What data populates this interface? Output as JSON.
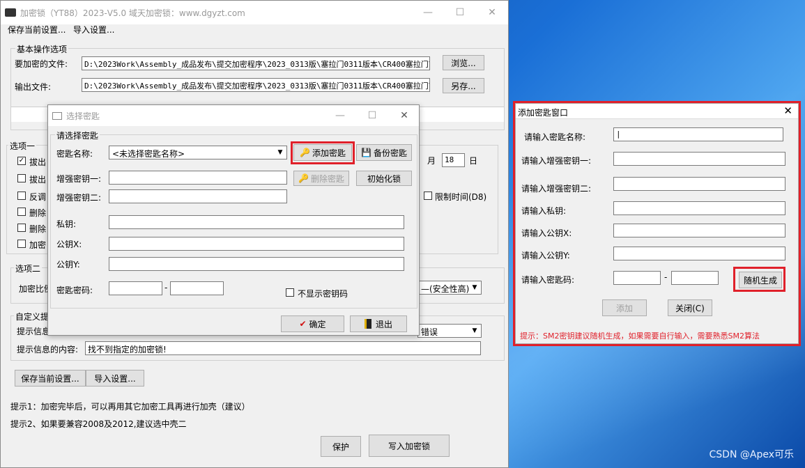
{
  "main": {
    "title": "加密锁（YT88）2023-V5.0 域天加密锁：www.dgyzt.com",
    "menu": [
      "保存当前设置...",
      "导入设置..."
    ],
    "basic_group": "基本操作选项",
    "file_label": "要加密的文件:",
    "file_value": "D:\\2023Work\\Assembly_成品发布\\提交加密程序\\2023_0313版\\塞拉门0311版本\\CR400塞拉门\\C",
    "browse_btn": "浏览...",
    "output_label": "输出文件:",
    "output_value": "D:\\2023Work\\Assembly_成品发布\\提交加密程序\\2023_0313版\\塞拉门0311版本\\CR400塞拉门\\C",
    "saveas_btn": "另存...",
    "opt1_group": "选项一",
    "opt1_items": [
      "拔出",
      "拔出",
      "反调",
      "删除",
      "删除",
      "加密"
    ],
    "month_label": "月",
    "day_value": "18",
    "day_label": "日",
    "limit_time": "限制时间(D8)",
    "opt2_group": "选项二",
    "ratio_label": "加密比例",
    "security_select": "—(安全性高)",
    "custom_group": "自定义提",
    "tipinfo_label": "提示信息",
    "tip_select": "错误",
    "tipcontent_label": "提示信息的内容:",
    "tipcontent_value": "找不到指定的加密锁!",
    "save_btn": "保存当前设置...",
    "import_btn": "导入设置...",
    "hint1": "提示1：加密完毕后，可以再用其它加密工具再进行加壳（建议）",
    "hint2": "提示2、如果要兼容2008及2012,建议选中壳二",
    "protect_btn": "保护",
    "write_btn": "写入加密锁"
  },
  "select_dlg": {
    "title": "选择密匙",
    "group": "请选择密匙",
    "name_label": "密匙名称:",
    "name_select": "<未选择密匙名称>",
    "add_btn": "添加密匙",
    "backup_btn": "备份密匙",
    "enh1_label": "增强密钥一:",
    "delete_btn": "删除密匙",
    "init_btn": "初始化锁",
    "enh2_label": "增强密钥二:",
    "priv_label": "私钥:",
    "pubx_label": "公钥X:",
    "puby_label": "公钥Y:",
    "pwd_label": "密匙密码:",
    "dash": "-",
    "hide_pwd": "不显示密钥码",
    "ok_btn": "确定",
    "exit_btn": "退出"
  },
  "add_dlg": {
    "title": "添加密匙窗口",
    "name_label": "请输入密匙名称:",
    "enh1_label": "请输入增强密钥一:",
    "enh2_label": "请输入增强密钥二:",
    "priv_label": "请输入私钥:",
    "pubx_label": "请输入公钥X:",
    "puby_label": "请输入公钥Y:",
    "code_label": "请输入密匙码:",
    "dash": "-",
    "random_btn": "随机生成",
    "add_btn": "添加",
    "close_btn": "关闭(C)",
    "tip": "提示：SM2密钥建议随机生成，如果需要自行输入，需要熟悉SM2算法"
  },
  "watermark": "CSDN @Apex可乐",
  "colors": {
    "highlight": "#e0202a",
    "tip_text": "#e0202a"
  }
}
